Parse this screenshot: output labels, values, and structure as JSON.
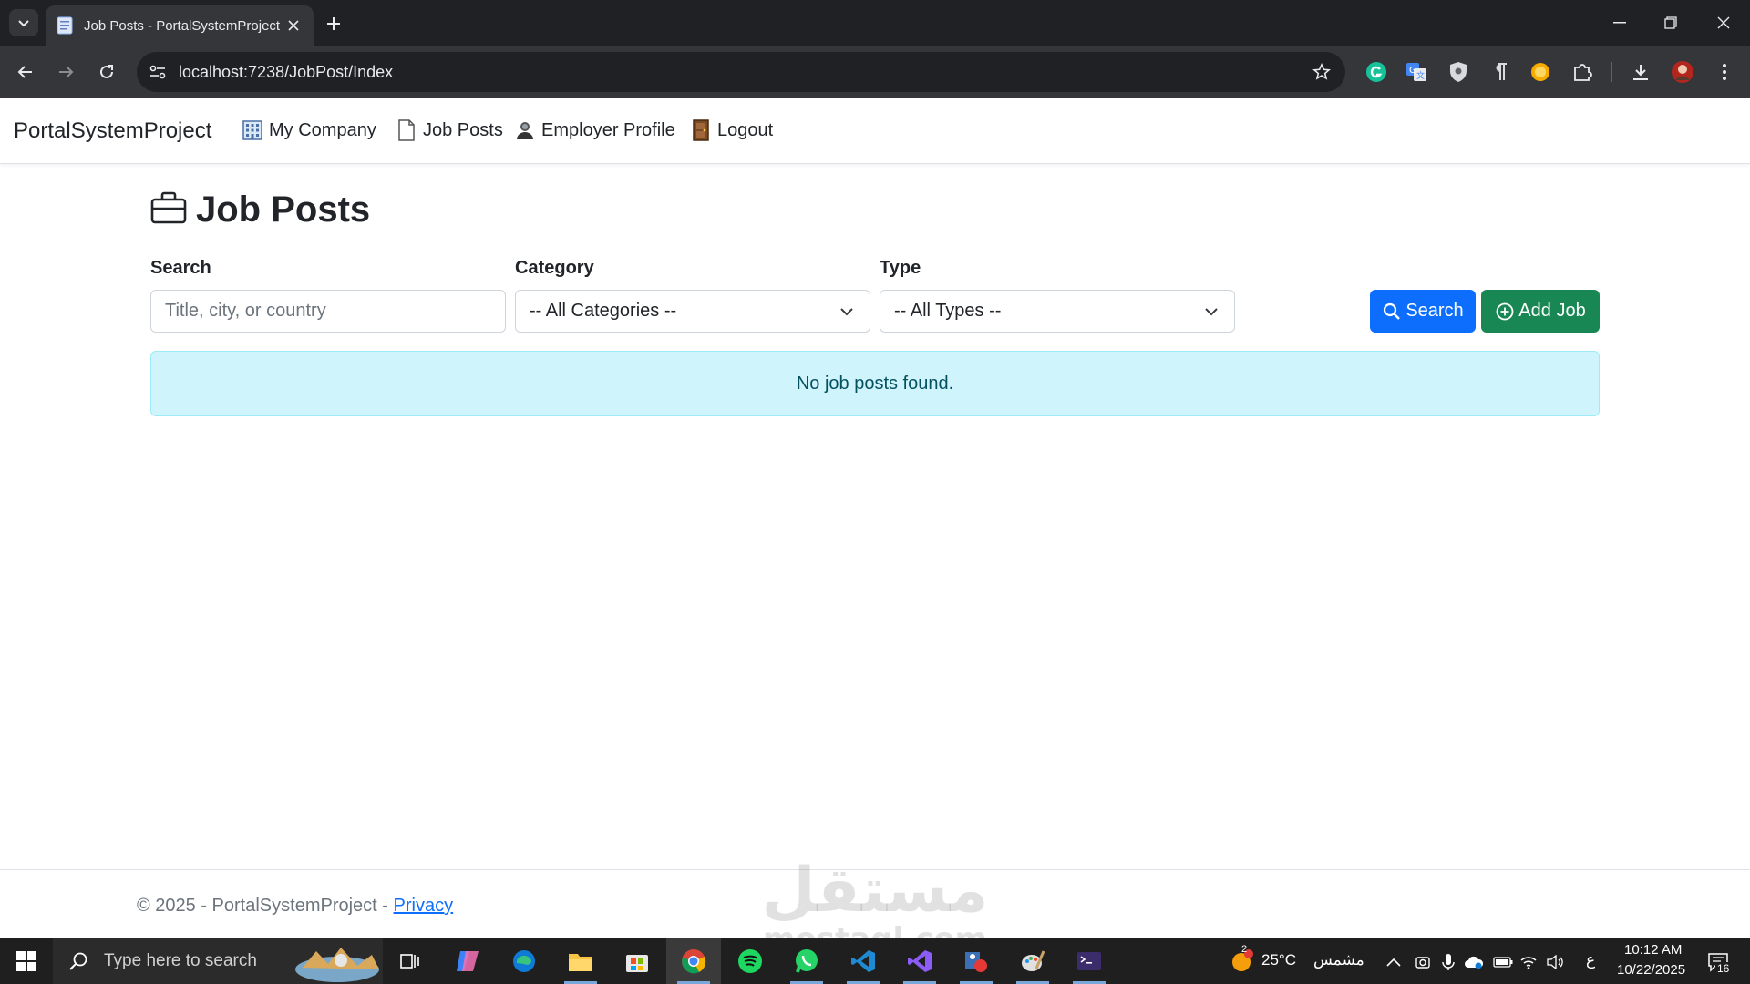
{
  "browser": {
    "tab_title": "Job Posts - PortalSystemProject",
    "url": "localhost:7238/JobPost/Index"
  },
  "nav": {
    "brand": "PortalSystemProject",
    "items": [
      {
        "label": "My Company",
        "icon": "building-icon"
      },
      {
        "label": "Job Posts",
        "icon": "document-icon"
      },
      {
        "label": "Employer Profile",
        "icon": "user-icon"
      },
      {
        "label": "Logout",
        "icon": "door-icon"
      }
    ]
  },
  "page": {
    "title": "Job Posts",
    "filters": {
      "search_label": "Search",
      "search_placeholder": "Title, city, or country",
      "category_label": "Category",
      "category_selected": "-- All Categories --",
      "type_label": "Type",
      "type_selected": "-- All Types --"
    },
    "buttons": {
      "search": "Search",
      "add_job": "Add Job"
    },
    "empty_message": "No job posts found."
  },
  "footer": {
    "text": "© 2025 - PortalSystemProject - ",
    "privacy": "Privacy"
  },
  "watermark": {
    "line1": "مستقل",
    "line2": "mostaql.com"
  },
  "taskbar": {
    "search_placeholder": "Type here to search",
    "weather_temp": "25°C",
    "weather_desc": "مشمس",
    "weather_badge": "2",
    "lang": "ع",
    "time": "10:12 AM",
    "date": "10/22/2025",
    "notifications": "16"
  },
  "colors": {
    "primary": "#0d6efd",
    "success": "#198754",
    "alert_bg": "#cff4fc",
    "alert_text": "#055160"
  }
}
